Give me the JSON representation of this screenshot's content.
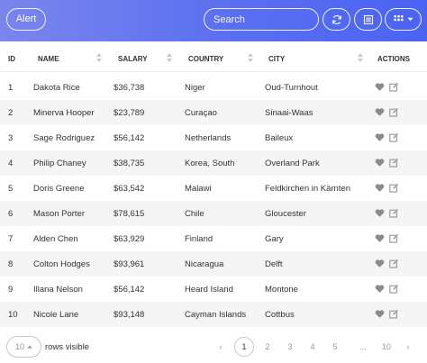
{
  "toolbar": {
    "alert_label": "Alert",
    "search_placeholder": "Search"
  },
  "table": {
    "columns": [
      "ID",
      "NAME",
      "SALARY",
      "COUNTRY",
      "CITY",
      "ACTIONS"
    ],
    "rows": [
      {
        "id": "1",
        "name": "Dakota Rice",
        "salary": "$36,738",
        "country": "Niger",
        "city": "Oud-Turnhout"
      },
      {
        "id": "2",
        "name": "Minerva Hooper",
        "salary": "$23,789",
        "country": "Curaçao",
        "city": "Sinaai-Waas"
      },
      {
        "id": "3",
        "name": "Sage Rodriguez",
        "salary": "$56,142",
        "country": "Netherlands",
        "city": "Baileux"
      },
      {
        "id": "4",
        "name": "Philip Chaney",
        "salary": "$38,735",
        "country": "Korea, South",
        "city": "Overland Park"
      },
      {
        "id": "5",
        "name": "Doris Greene",
        "salary": "$63,542",
        "country": "Malawi",
        "city": "Feldkirchen in Kärnten"
      },
      {
        "id": "6",
        "name": "Mason Porter",
        "salary": "$78,615",
        "country": "Chile",
        "city": "Gloucester"
      },
      {
        "id": "7",
        "name": "Alden Chen",
        "salary": "$63,929",
        "country": "Finland",
        "city": "Gary"
      },
      {
        "id": "8",
        "name": "Colton Hodges",
        "salary": "$93,961",
        "country": "Nicaragua",
        "city": "Delft"
      },
      {
        "id": "9",
        "name": "Illana Nelson",
        "salary": "$56,142",
        "country": "Heard Island",
        "city": "Montone"
      },
      {
        "id": "10",
        "name": "Nicole Lane",
        "salary": "$93,148",
        "country": "Cayman Islands",
        "city": "Cottbus"
      }
    ]
  },
  "footer": {
    "page_size": "10",
    "rows_visible_label": "rows visible",
    "pagination": {
      "prev": "‹",
      "pages": [
        "1",
        "2",
        "3",
        "4",
        "5",
        "...",
        "10"
      ],
      "next": "›",
      "active": "1"
    }
  },
  "colors": {
    "toolbar_start": "#7a86ee",
    "toolbar_end": "#4b63f3",
    "row_alt": "#f5f5f5",
    "icon": "#8a8a8a"
  },
  "icons": {
    "refresh": "refresh-icon",
    "columns": "columns-icon",
    "grid": "grid-icon",
    "like": "heart-icon",
    "edit": "edit-icon"
  }
}
